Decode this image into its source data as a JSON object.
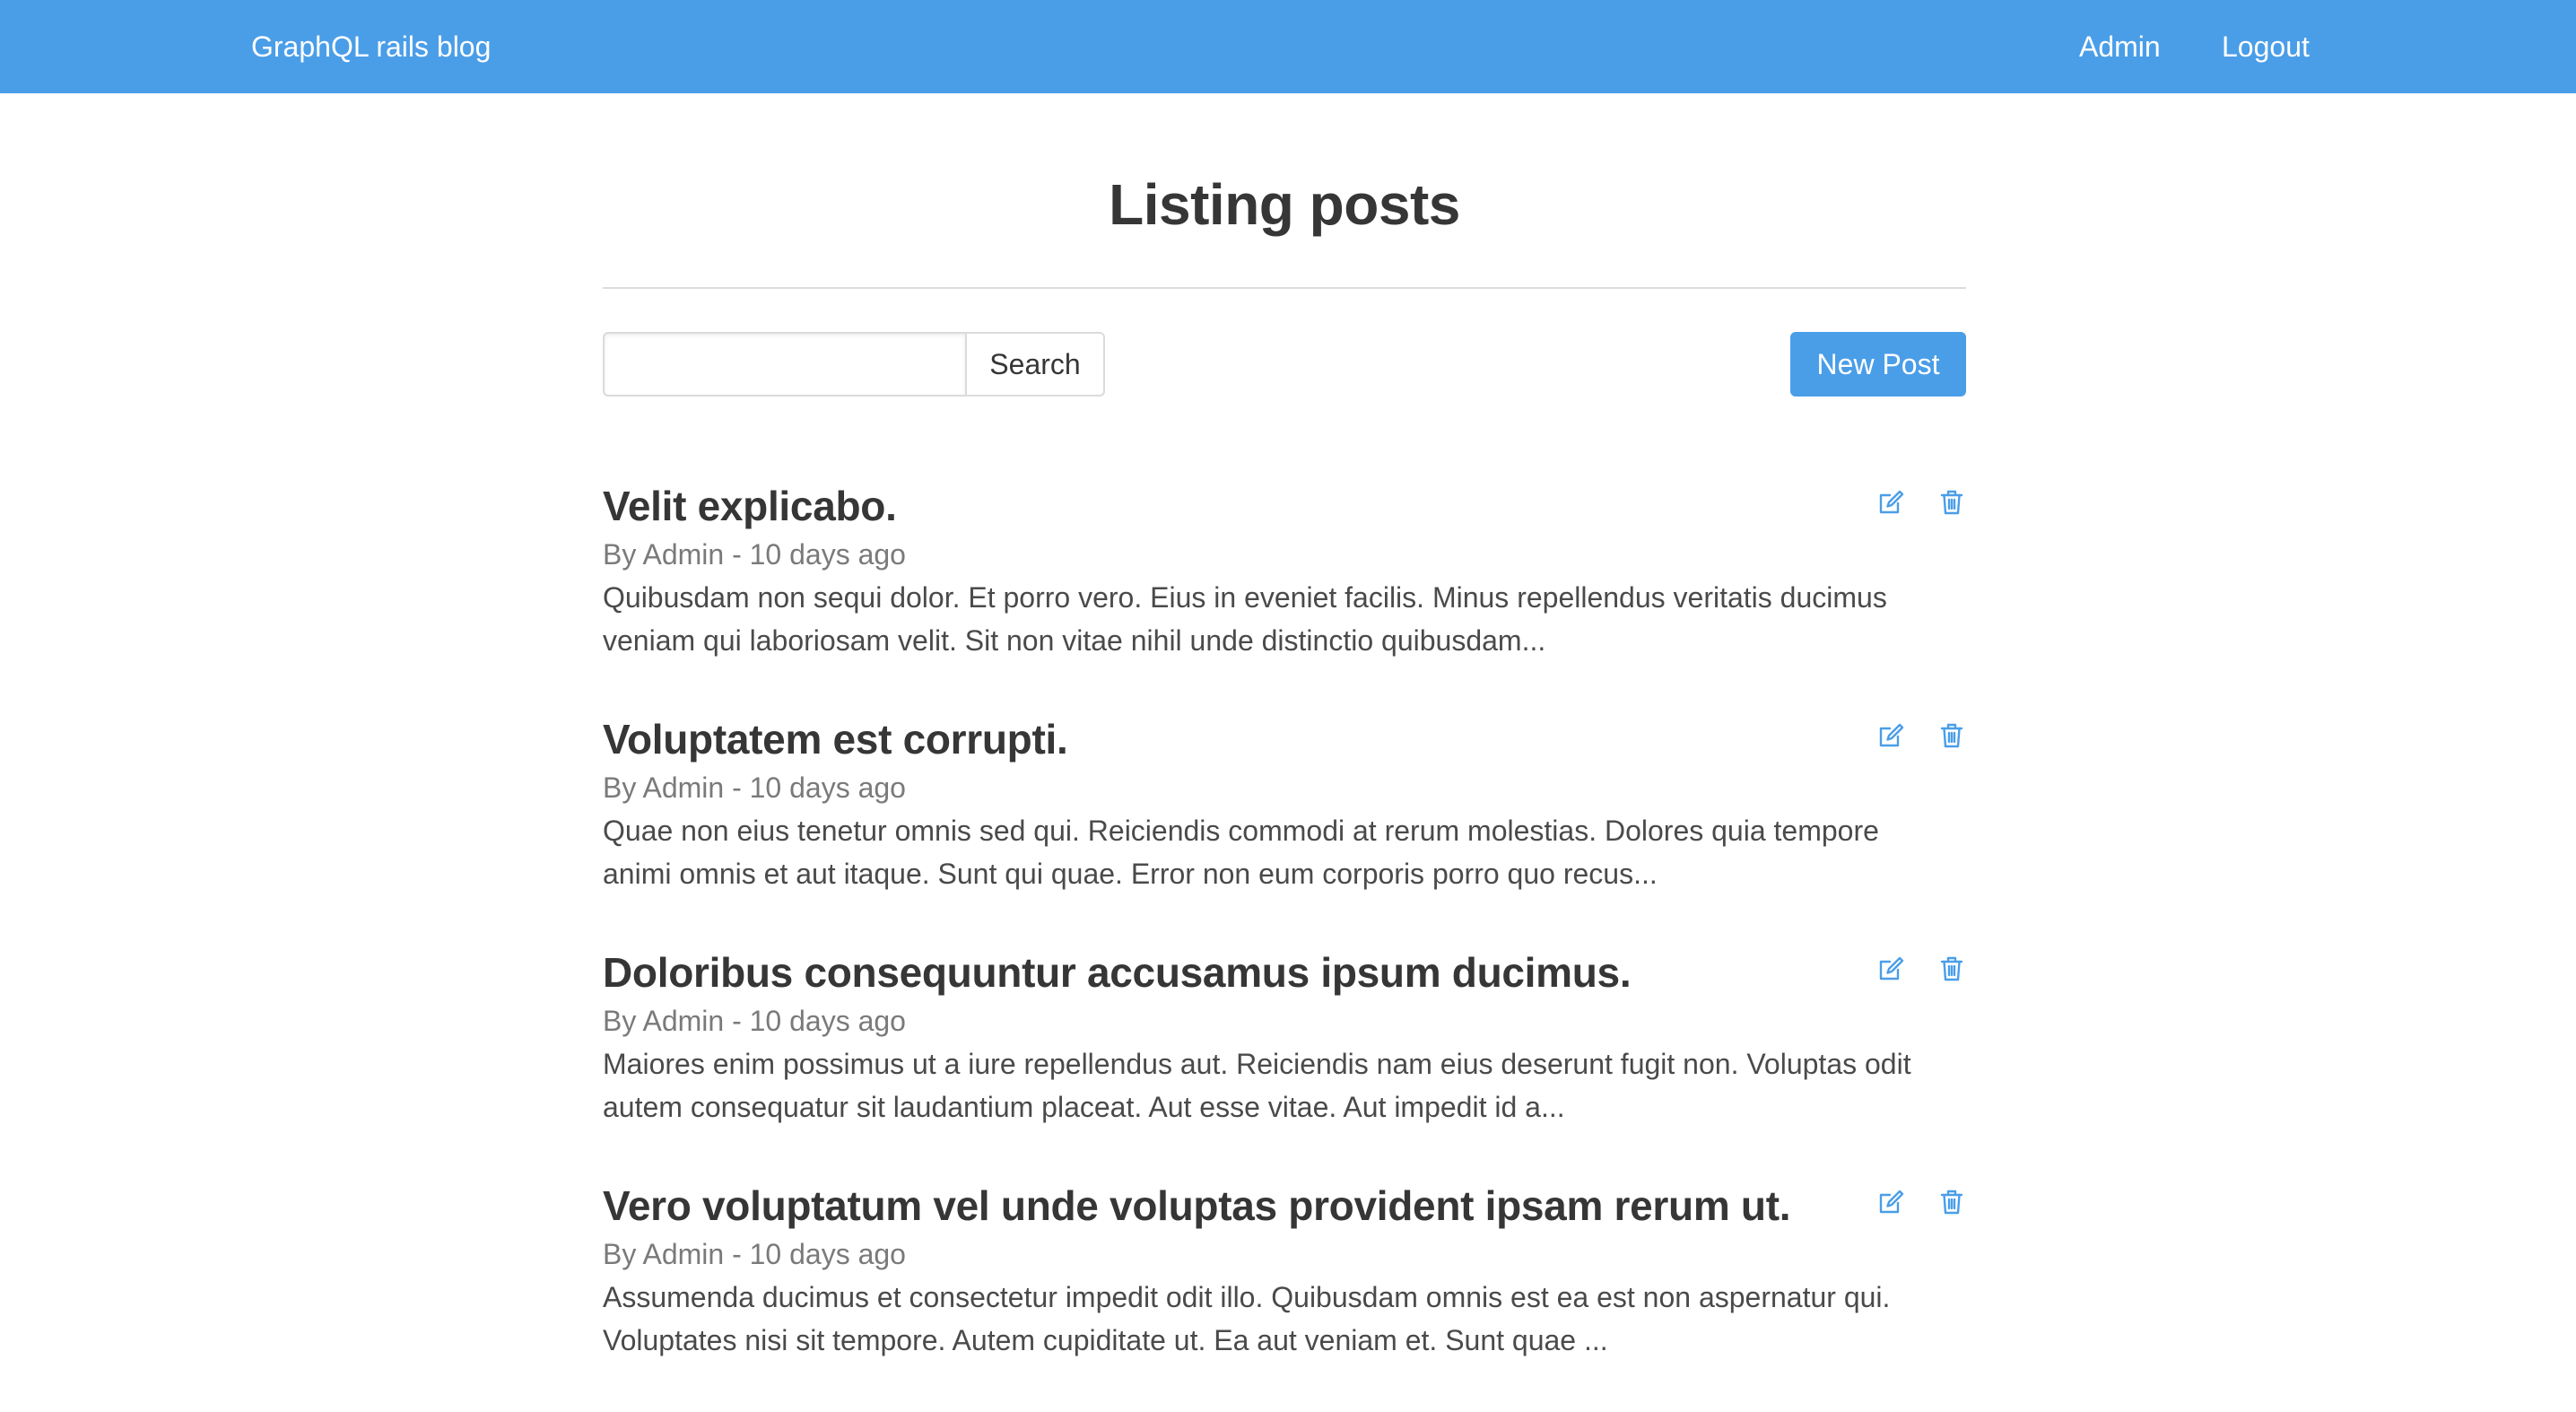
{
  "navbar": {
    "brand": "GraphQL rails blog",
    "admin_link": "Admin",
    "logout_link": "Logout",
    "background_color": "#4a9ee8"
  },
  "page": {
    "title": "Listing posts"
  },
  "search": {
    "value": "",
    "placeholder": "",
    "button_label": "Search"
  },
  "new_post": {
    "label": "New Post"
  },
  "icons": {
    "edit": "edit-icon",
    "delete": "trash-icon"
  },
  "posts": [
    {
      "title": "Velit explicabo.",
      "meta": "By Admin - 10 days ago",
      "excerpt": "Quibusdam non sequi dolor. Et porro vero. Eius in eveniet facilis. Minus repellendus veritatis ducimus veniam qui laboriosam velit. Sit non vitae nihil unde distinctio quibusdam..."
    },
    {
      "title": "Voluptatem est corrupti.",
      "meta": "By Admin - 10 days ago",
      "excerpt": "Quae non eius tenetur omnis sed qui. Reiciendis commodi at rerum molestias. Dolores quia tempore animi omnis et aut itaque. Sunt qui quae. Error non eum corporis porro quo recus..."
    },
    {
      "title": "Doloribus consequuntur accusamus ipsum ducimus.",
      "meta": "By Admin - 10 days ago",
      "excerpt": "Maiores enim possimus ut a iure repellendus aut. Reiciendis nam eius deserunt fugit non. Voluptas odit autem consequatur sit laudantium placeat. Aut esse vitae. Aut impedit id a..."
    },
    {
      "title": "Vero voluptatum vel unde voluptas provident ipsam rerum ut.",
      "meta": "By Admin - 10 days ago",
      "excerpt": "Assumenda ducimus et consectetur impedit odit illo. Quibusdam omnis est ea est non aspernatur qui. Voluptates nisi sit tempore. Autem cupiditate ut. Ea aut veniam et. Sunt quae ..."
    }
  ]
}
